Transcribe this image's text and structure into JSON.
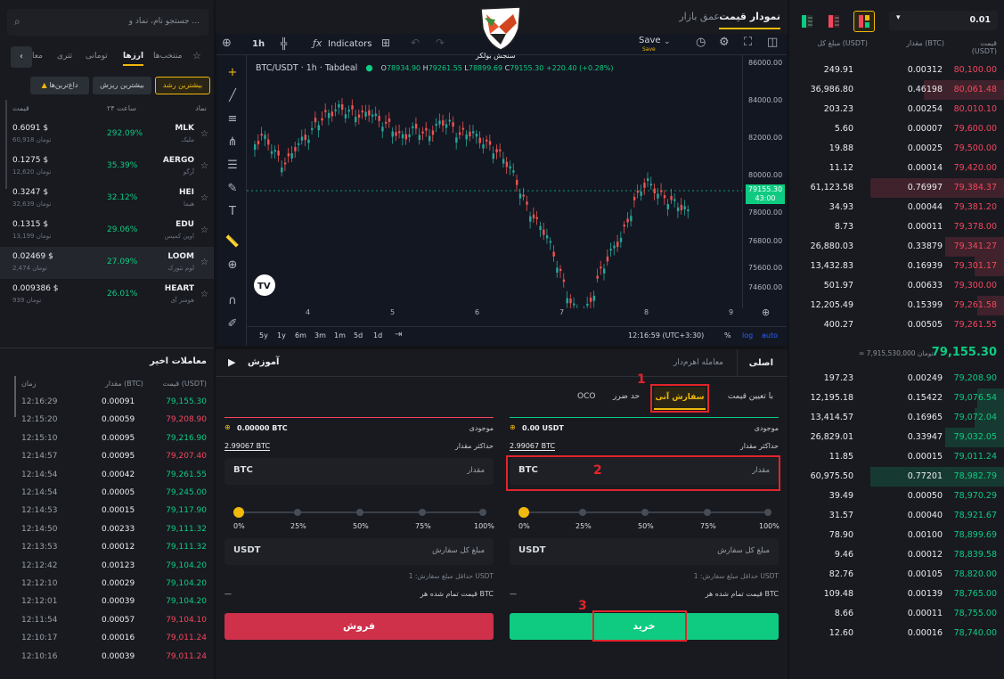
{
  "left": {
    "search_placeholder": "جستجو نام، نماد و ...",
    "tabs": [
      "منتخب‌ها",
      "ارزها",
      "تومانی",
      "تتری",
      "معا"
    ],
    "filters": [
      "بیشترین رشد",
      "بیشترین ریزش",
      "داغ‌ترین‌ها"
    ],
    "headers": {
      "symbol": "نماد",
      "change": "۲۴ ساعت",
      "price": "قیمت"
    },
    "markets": [
      {
        "symbol": "MLK",
        "name": "ملیک",
        "change": "292.09%",
        "price": "0.6091 $",
        "vol": "60,918 تومان"
      },
      {
        "symbol": "AERGO",
        "name": "آرگو",
        "change": "35.39%",
        "price": "0.1275 $",
        "vol": "12,620 تومان"
      },
      {
        "symbol": "HEI",
        "name": "هیما",
        "change": "32.12%",
        "price": "0.3247 $",
        "vol": "32,639 تومان"
      },
      {
        "symbol": "EDU",
        "name": "اوپن کمپس",
        "change": "29.06%",
        "price": "0.1315 $",
        "vol": "13,199 تومان"
      },
      {
        "symbol": "LOOM",
        "name": "لوم نتورک",
        "change": "27.09%",
        "price": "0.02469 $",
        "vol": "2,474 تومان"
      },
      {
        "symbol": "HEART",
        "name": "هومنز آی",
        "change": "26.01%",
        "price": "0.009386 $",
        "vol": "939 تومان"
      }
    ],
    "trades_title": "معاملات اخیر",
    "trades_headers": {
      "price": "قیمت (USDT)",
      "amount": "مقدار (BTC)",
      "time": "زمان"
    },
    "trades": [
      {
        "p": "79,155.30",
        "a": "0.00091",
        "t": "12:16:29",
        "s": "g"
      },
      {
        "p": "79,208.90",
        "a": "0.00059",
        "t": "12:15:20",
        "s": "r"
      },
      {
        "p": "79,216.90",
        "a": "0.00095",
        "t": "12:15:10",
        "s": "g"
      },
      {
        "p": "79,207.40",
        "a": "0.00095",
        "t": "12:14:57",
        "s": "r"
      },
      {
        "p": "79,261.55",
        "a": "0.00042",
        "t": "12:14:54",
        "s": "g"
      },
      {
        "p": "79,245.00",
        "a": "0.00005",
        "t": "12:14:54",
        "s": "g"
      },
      {
        "p": "79,117.90",
        "a": "0.00015",
        "t": "12:14:53",
        "s": "g"
      },
      {
        "p": "79,111.32",
        "a": "0.00233",
        "t": "12:14:50",
        "s": "g"
      },
      {
        "p": "79,111.32",
        "a": "0.00012",
        "t": "12:13:53",
        "s": "g"
      },
      {
        "p": "79,104.20",
        "a": "0.00123",
        "t": "12:12:42",
        "s": "g"
      },
      {
        "p": "79,104.20",
        "a": "0.00029",
        "t": "12:12:10",
        "s": "g"
      },
      {
        "p": "79,104.20",
        "a": "0.00039",
        "t": "12:12:01",
        "s": "g"
      },
      {
        "p": "79,104.10",
        "a": "0.00057",
        "t": "12:11:54",
        "s": "r"
      },
      {
        "p": "79,011.24",
        "a": "0.00016",
        "t": "12:10:17",
        "s": "r"
      },
      {
        "p": "79,011.24",
        "a": "0.00039",
        "t": "12:10:16",
        "s": "r"
      }
    ]
  },
  "center": {
    "tabs": [
      "نمودار قیمت",
      "عمق بازار"
    ],
    "logo_text": "سنجش بولکر",
    "toolbar": {
      "interval": "1h",
      "indicators": "Indicators",
      "save": "Save",
      "save_sub": "Save"
    },
    "legend": {
      "title": "BTC/USDT · 1h · Tabdeal",
      "o": "78934.90",
      "h": "79261.55",
      "l": "78899.69",
      "c": "79155.30",
      "chg": "+220.40 (+0.28%)"
    },
    "yticks": [
      "86000.00",
      "84000.00",
      "82000.00",
      "80000.00",
      "78000.00",
      "76800.00",
      "75600.00",
      "74600.00"
    ],
    "xticks": [
      "4",
      "5",
      "6",
      "7",
      "8",
      "9"
    ],
    "price_tag": "79155.30",
    "price_tag_time": "43:00",
    "ranges": [
      "5y",
      "1y",
      "6m",
      "3m",
      "1m",
      "5d",
      "1d"
    ],
    "clock": "12:16:59 (UTC+3:30)",
    "scale_opts": [
      "%",
      "log",
      "auto"
    ],
    "order_tabs": [
      "اصلی",
      "معامله اهرم‌دار"
    ],
    "education": "آموزش",
    "order_types": [
      "با تعیین قیمت",
      "سفارش آنی",
      "حد ضرر",
      "OCO"
    ],
    "buy": {
      "balance_label": "موجودی",
      "balance": "0.00 USDT",
      "max_label": "حداکثر مقدار",
      "max": "2.99067 BTC",
      "amount_label": "مقدار",
      "amount_unit": "BTC",
      "total_label": "مبلغ کل سفارش",
      "total_unit": "USDT",
      "min_text": "حداقل مبلغ سفارش: 1 USDT",
      "finished_label": "قیمت تمام شده هر BTC",
      "finished_val": "—",
      "button": "خرید"
    },
    "sell": {
      "balance_label": "موجودی",
      "balance": "0.00000 BTC",
      "max_label": "حداکثر مقدار",
      "max": "2.99067 BTC",
      "amount_label": "مقدار",
      "amount_unit": "BTC",
      "total_label": "مبلغ کل سفارش",
      "total_unit": "USDT",
      "min_text": "حداقل مبلغ سفارش: 1 USDT",
      "finished_label": "قیمت تمام شده هر BTC",
      "finished_val": "—",
      "button": "فروش"
    },
    "pcts": [
      "0%",
      "25%",
      "50%",
      "75%",
      "100%"
    ],
    "slider_value": 0,
    "annotations": [
      "1",
      "2",
      "3"
    ]
  },
  "orderbook": {
    "precision": "0.01",
    "headers": {
      "price": "قیمت (USDT)",
      "amount": "مقدار (BTC)",
      "total": "مبلغ کل (USDT)"
    },
    "asks": [
      {
        "p": "80,100.00",
        "a": "0.00312",
        "t": "249.91",
        "d": 0
      },
      {
        "p": "80,061.48",
        "a": "0.46198",
        "t": "36,986.80",
        "d": 0.6
      },
      {
        "p": "80,010.10",
        "a": "0.00254",
        "t": "203.23",
        "d": 0
      },
      {
        "p": "79,600.00",
        "a": "0.00007",
        "t": "5.60",
        "d": 0
      },
      {
        "p": "79,500.00",
        "a": "0.00025",
        "t": "19.88",
        "d": 0
      },
      {
        "p": "79,420.00",
        "a": "0.00014",
        "t": "11.12",
        "d": 0
      },
      {
        "p": "79,384.37",
        "a": "0.76997",
        "t": "61,123.58",
        "d": 1
      },
      {
        "p": "79,381.20",
        "a": "0.00044",
        "t": "34.93",
        "d": 0
      },
      {
        "p": "79,378.00",
        "a": "0.00011",
        "t": "8.73",
        "d": 0
      },
      {
        "p": "79,341.27",
        "a": "0.33879",
        "t": "26,880.03",
        "d": 0.44
      },
      {
        "p": "79,301.17",
        "a": "0.16939",
        "t": "13,432.83",
        "d": 0.22
      },
      {
        "p": "79,300.00",
        "a": "0.00633",
        "t": "501.97",
        "d": 0
      },
      {
        "p": "79,261.58",
        "a": "0.15399",
        "t": "12,205.49",
        "d": 0.2
      },
      {
        "p": "79,261.55",
        "a": "0.00505",
        "t": "400.27",
        "d": 0
      }
    ],
    "last_price": "79,155.30",
    "last_toman": "≈ 7,915,530,000 تومان",
    "bids": [
      {
        "p": "79,208.90",
        "a": "0.00249",
        "t": "197.23",
        "d": 0
      },
      {
        "p": "79,076.54",
        "a": "0.15422",
        "t": "12,195.18",
        "d": 0.2
      },
      {
        "p": "79,072.04",
        "a": "0.16965",
        "t": "13,414.57",
        "d": 0.22
      },
      {
        "p": "79,032.05",
        "a": "0.33947",
        "t": "26,829.01",
        "d": 0.44
      },
      {
        "p": "79,011.24",
        "a": "0.00015",
        "t": "11.85",
        "d": 0
      },
      {
        "p": "78,982.79",
        "a": "0.77201",
        "t": "60,975.50",
        "d": 1
      },
      {
        "p": "78,970.29",
        "a": "0.00050",
        "t": "39.49",
        "d": 0
      },
      {
        "p": "78,921.67",
        "a": "0.00040",
        "t": "31.57",
        "d": 0
      },
      {
        "p": "78,899.69",
        "a": "0.00100",
        "t": "78.90",
        "d": 0
      },
      {
        "p": "78,839.58",
        "a": "0.00012",
        "t": "9.46",
        "d": 0
      },
      {
        "p": "78,820.00",
        "a": "0.00105",
        "t": "82.76",
        "d": 0
      },
      {
        "p": "78,765.00",
        "a": "0.00139",
        "t": "109.48",
        "d": 0
      },
      {
        "p": "78,755.00",
        "a": "0.00011",
        "t": "8.66",
        "d": 0
      },
      {
        "p": "78,740.00",
        "a": "0.00016",
        "t": "12.60",
        "d": 0
      }
    ]
  }
}
